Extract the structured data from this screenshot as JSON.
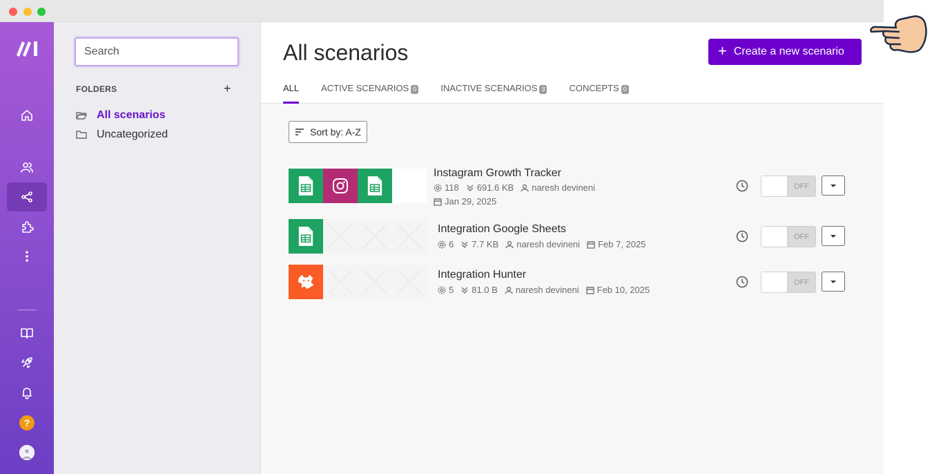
{
  "folders": {
    "search_placeholder": "Search",
    "heading": "FOLDERS",
    "add_label": "+",
    "items": [
      {
        "label": "All scenarios",
        "active": true
      },
      {
        "label": "Uncategorized",
        "active": false
      }
    ]
  },
  "rail": {
    "items": [
      "home-icon",
      "team-icon",
      "scenarios-icon",
      "apps-icon",
      "more-icon",
      "docs-icon",
      "rocket-icon",
      "bell-icon",
      "help-icon",
      "profile-icon"
    ],
    "help_label": "?"
  },
  "main": {
    "title": "All scenarios",
    "create_label": "Create a new scenario",
    "create_plus": "+",
    "tabs": [
      {
        "label": "ALL",
        "count": null
      },
      {
        "label": "ACTIVE SCENARIOS",
        "count": "0"
      },
      {
        "label": "INACTIVE SCENARIOS",
        "count": "3"
      },
      {
        "label": "CONCEPTS",
        "count": "0"
      }
    ],
    "sort_label": "Sort by: A-Z"
  },
  "scenarios": [
    {
      "name": "Instagram Growth Tracker",
      "operations": "118",
      "size": "691.6 KB",
      "owner": "naresh devineni",
      "date": "Jan 29, 2025",
      "toggle": "OFF"
    },
    {
      "name": "Integration Google Sheets",
      "operations": "6",
      "size": "7.7 KB",
      "owner": "naresh devineni",
      "date": "Feb 7, 2025",
      "toggle": "OFF"
    },
    {
      "name": "Integration Hunter",
      "operations": "5",
      "size": "81.0 B",
      "owner": "naresh devineni",
      "date": "Feb 10, 2025",
      "toggle": "OFF"
    }
  ],
  "colors": {
    "brand": "#6d00cc",
    "sheets": "#1ea362",
    "instagram": "#b32b73",
    "hunter": "#fb5b25"
  }
}
